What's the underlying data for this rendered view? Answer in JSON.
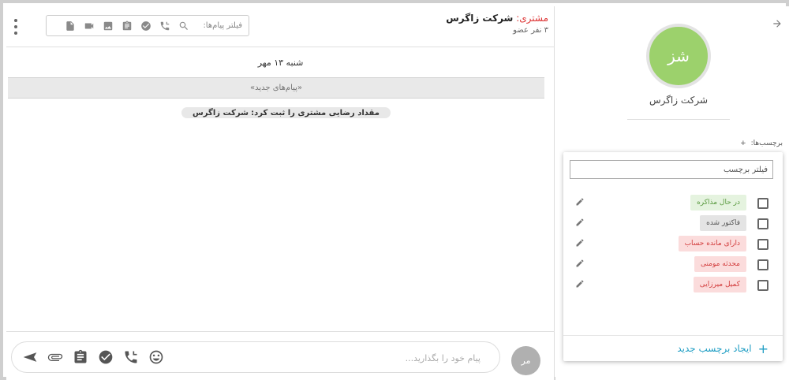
{
  "chat": {
    "title_prefix": "مشتری:",
    "title_name": "شرکت زاگرس",
    "members": "۳ نفر عضو",
    "filter_placeholder": "فیلتر پیام‌ها:",
    "date_separator": "شنبه ۱۳ مهر",
    "new_messages": "«پیام‌های جدید»",
    "system_message": {
      "action": "مقداد رضایی مشتری را ثبت کرد:",
      "subject": "شرکت زاگرس"
    },
    "filter_icons": [
      "search-icon",
      "call-icon",
      "check-circle-icon",
      "clipboard-icon",
      "image-icon",
      "video-icon",
      "document-icon"
    ]
  },
  "composer": {
    "placeholder": "پیام خود را بگذارید...",
    "my_avatar": "مر",
    "icons": [
      "send-icon",
      "attachment-icon",
      "clipboard-icon",
      "check-circle-icon",
      "call-icon",
      "emoji-icon"
    ]
  },
  "info": {
    "avatar_text": "شز",
    "company_name": "شرکت زاگرس",
    "tags_label": "برچسب‌ها:",
    "tags_add": "+",
    "avatar_color": "#9cd16c"
  },
  "tag_dropdown": {
    "filter_placeholder": "فیلتر برچسب",
    "tags": [
      {
        "label": "در حال مذاکره",
        "bg": "#e5f3df",
        "fg": "#5a9a40",
        "checked": false
      },
      {
        "label": "فاکتور شده",
        "bg": "#e4e4e4",
        "fg": "#555555",
        "checked": false
      },
      {
        "label": "دارای مانده حساب",
        "bg": "#fbdcdc",
        "fg": "#d23c3c",
        "checked": false
      },
      {
        "label": "محدثه مومنی",
        "bg": "#fbdcdc",
        "fg": "#d23c3c",
        "checked": false
      },
      {
        "label": "کمیل میرزایی",
        "bg": "#fbdcdc",
        "fg": "#d23c3c",
        "checked": false
      }
    ],
    "create_label": "ایجاد برچسب جدید",
    "create_plus": "+"
  }
}
